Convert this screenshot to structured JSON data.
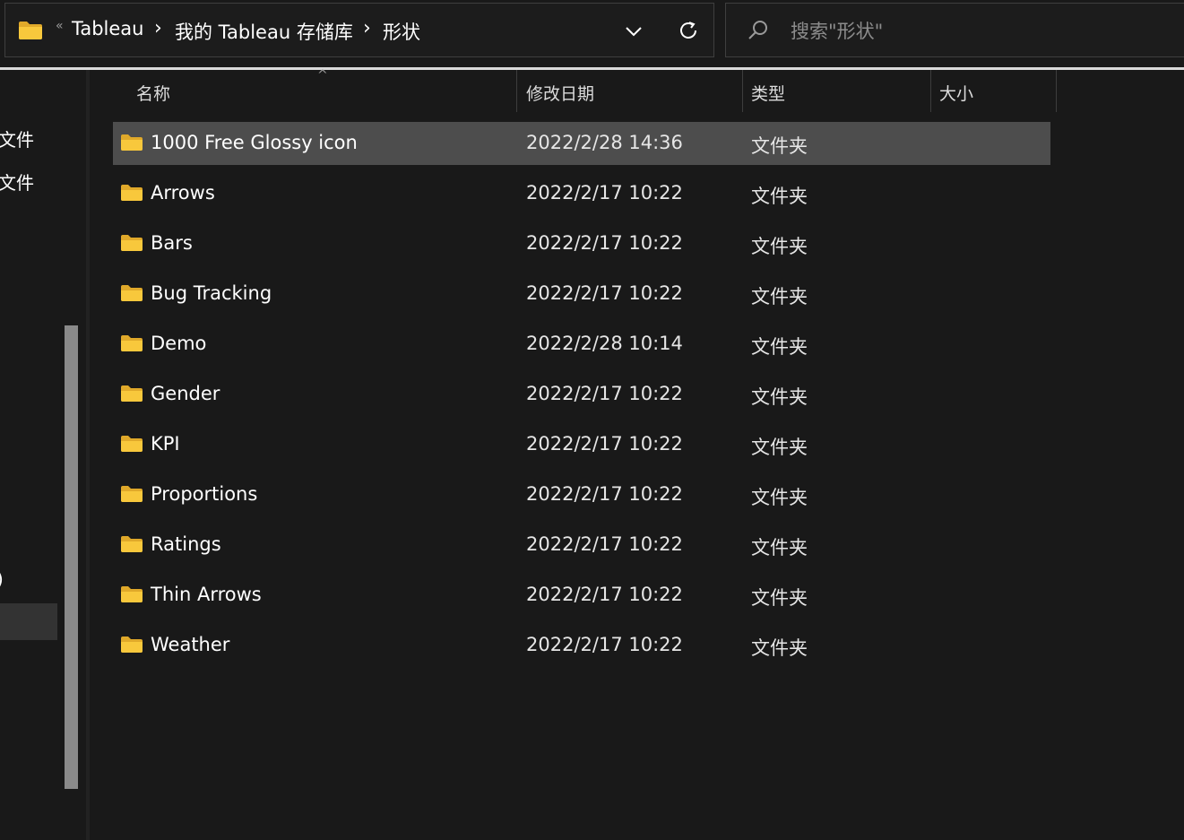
{
  "address_bar": {
    "overflow_chevron": "«",
    "crumbs": [
      "Tableau",
      "我的 Tableau 存储库",
      "形状"
    ],
    "separator": "›"
  },
  "search": {
    "placeholder": "搜索\"形状\"",
    "value": ""
  },
  "nav_pane": {
    "items": [
      "源文件",
      "源文件",
      ")"
    ]
  },
  "columns": {
    "name": "名称",
    "date": "修改日期",
    "type": "类型",
    "size": "大小",
    "sort_indicator": "^"
  },
  "files": [
    {
      "name": "1000 Free Glossy icon",
      "date": "2022/2/28 14:36",
      "type": "文件夹",
      "selected": true
    },
    {
      "name": "Arrows",
      "date": "2022/2/17 10:22",
      "type": "文件夹"
    },
    {
      "name": "Bars",
      "date": "2022/2/17 10:22",
      "type": "文件夹"
    },
    {
      "name": "Bug Tracking",
      "date": "2022/2/17 10:22",
      "type": "文件夹"
    },
    {
      "name": "Demo",
      "date": "2022/2/28 10:14",
      "type": "文件夹"
    },
    {
      "name": "Gender",
      "date": "2022/2/17 10:22",
      "type": "文件夹"
    },
    {
      "name": "KPI",
      "date": "2022/2/17 10:22",
      "type": "文件夹"
    },
    {
      "name": "Proportions",
      "date": "2022/2/17 10:22",
      "type": "文件夹"
    },
    {
      "name": "Ratings",
      "date": "2022/2/17 10:22",
      "type": "文件夹"
    },
    {
      "name": "Thin Arrows",
      "date": "2022/2/17 10:22",
      "type": "文件夹"
    },
    {
      "name": "Weather",
      "date": "2022/2/17 10:22",
      "type": "文件夹"
    }
  ],
  "icons": {
    "folder": "folder-icon",
    "dropdown": "chevron-down-icon",
    "refresh": "refresh-icon",
    "search": "search-icon"
  },
  "colors": {
    "folder_yellow": "#f8c83c",
    "folder_dark": "#e0a92a",
    "selection": "#4d4d4d",
    "background": "#191919"
  }
}
